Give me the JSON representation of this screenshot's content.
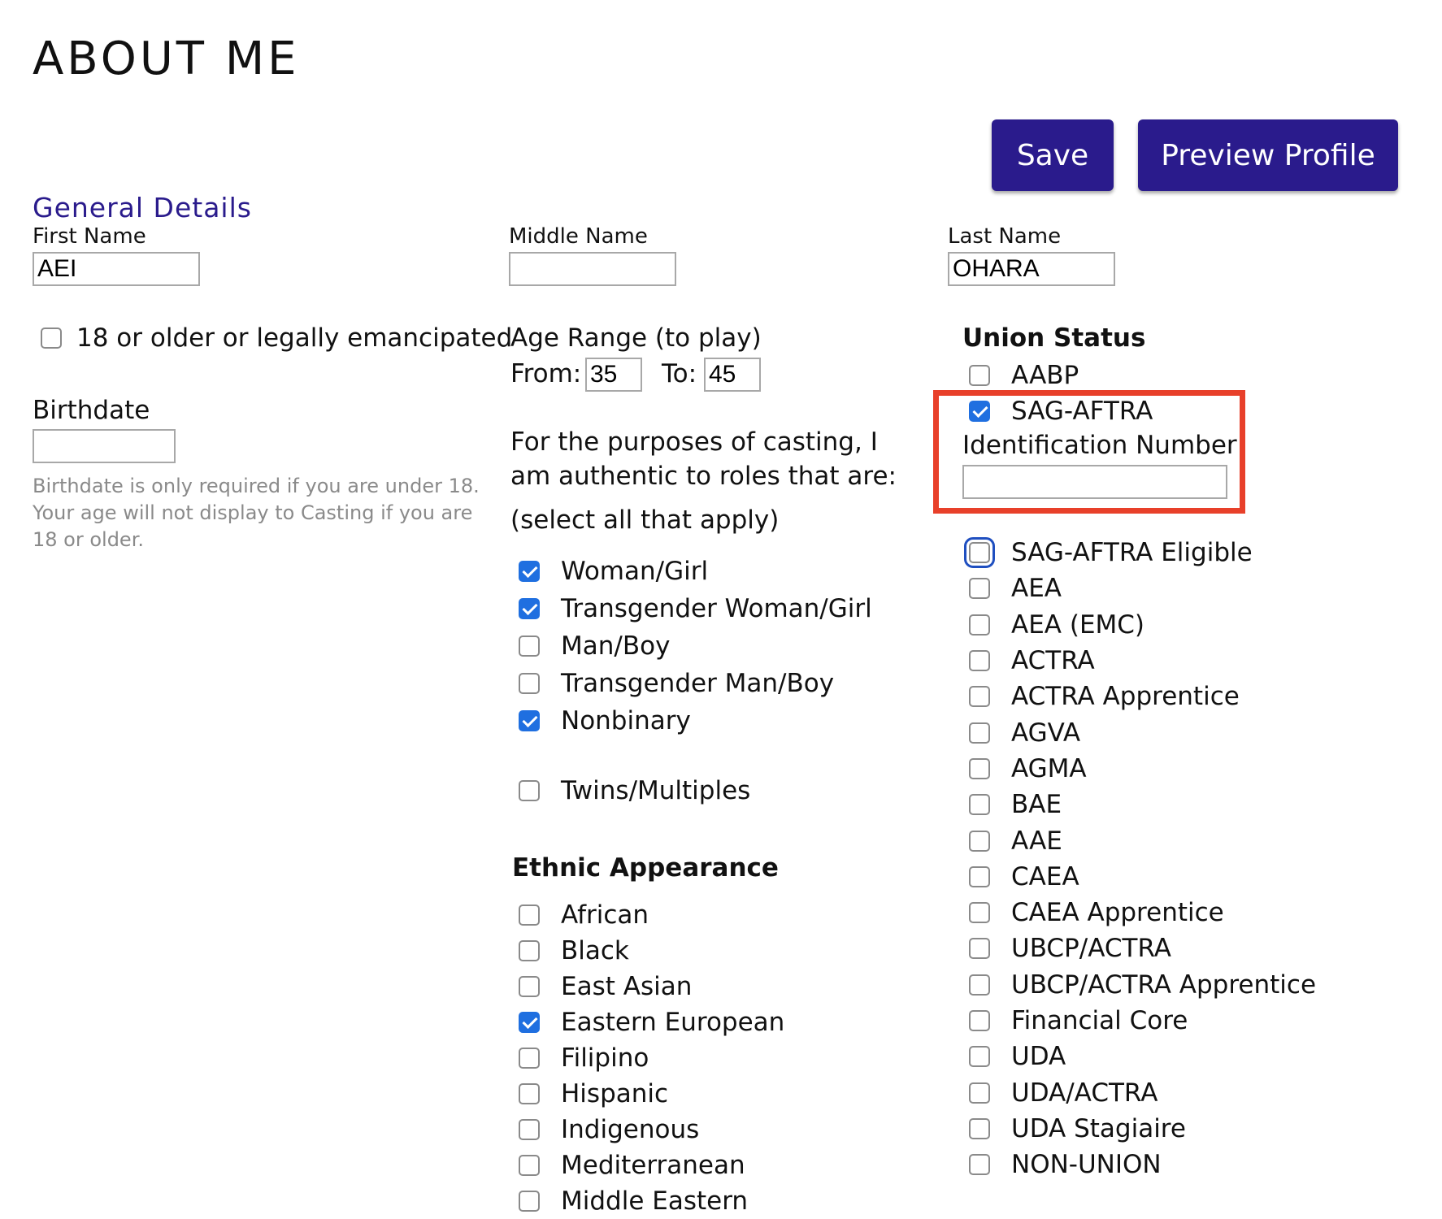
{
  "page": {
    "title": "ABOUT ME"
  },
  "toolbar": {
    "save_label": "Save",
    "preview_label": "Preview Profile",
    "accent": "#2a1b8c"
  },
  "general": {
    "title": "General Details",
    "first_name_label": "First Name",
    "first_name_value": "AEI",
    "middle_name_label": "Middle Name",
    "middle_name_value": "",
    "last_name_label": "Last Name",
    "last_name_value": "OHARA",
    "adult_label": "18 or older or legally emancipated",
    "adult_checked": false,
    "birthdate_label": "Birthdate",
    "birthdate_value": "",
    "birthdate_hint": "Birthdate is only required if you are under 18. Your age will not display to Casting if you are 18 or older."
  },
  "age_range": {
    "title": "Age Range (to play)",
    "from_label": "From:",
    "from_value": "35",
    "to_label": "To:",
    "to_value": "45"
  },
  "casting": {
    "line1": "For the purposes of casting, I",
    "line2": "am authentic to roles that are:",
    "line3": "(select all that apply)",
    "options": [
      {
        "label": "Woman/Girl",
        "checked": true
      },
      {
        "label": "Transgender Woman/Girl",
        "checked": true
      },
      {
        "label": "Man/Boy",
        "checked": false
      },
      {
        "label": "Transgender Man/Boy",
        "checked": false
      },
      {
        "label": "Nonbinary",
        "checked": true
      }
    ],
    "twins_label": "Twins/Multiples",
    "twins_checked": false
  },
  "ethnic": {
    "title": "Ethnic Appearance",
    "options": [
      {
        "label": "African",
        "checked": false
      },
      {
        "label": "Black",
        "checked": false
      },
      {
        "label": "East Asian",
        "checked": false
      },
      {
        "label": "Eastern European",
        "checked": true
      },
      {
        "label": "Filipino",
        "checked": false
      },
      {
        "label": "Hispanic",
        "checked": false
      },
      {
        "label": "Indigenous",
        "checked": false
      },
      {
        "label": "Mediterranean",
        "checked": false
      },
      {
        "label": "Middle Eastern",
        "checked": false
      }
    ]
  },
  "union": {
    "title": "Union Status",
    "aabp_label": "AABP",
    "aabp_checked": false,
    "sag_label": "SAG-AFTRA",
    "sag_checked": true,
    "id_label": "Identification Number",
    "id_value": "",
    "highlight_color": "#e8402a",
    "options": [
      {
        "label": "SAG-AFTRA Eligible",
        "checked": false,
        "focused": true
      },
      {
        "label": "AEA",
        "checked": false
      },
      {
        "label": "AEA (EMC)",
        "checked": false
      },
      {
        "label": "ACTRA",
        "checked": false
      },
      {
        "label": "ACTRA Apprentice",
        "checked": false
      },
      {
        "label": "AGVA",
        "checked": false
      },
      {
        "label": "AGMA",
        "checked": false
      },
      {
        "label": "BAE",
        "checked": false
      },
      {
        "label": "AAE",
        "checked": false
      },
      {
        "label": "CAEA",
        "checked": false
      },
      {
        "label": "CAEA Apprentice",
        "checked": false
      },
      {
        "label": "UBCP/ACTRA",
        "checked": false
      },
      {
        "label": "UBCP/ACTRA Apprentice",
        "checked": false
      },
      {
        "label": "Financial Core",
        "checked": false
      },
      {
        "label": "UDA",
        "checked": false
      },
      {
        "label": "UDA/ACTRA",
        "checked": false
      },
      {
        "label": "UDA Stagiaire",
        "checked": false
      },
      {
        "label": "NON-UNION",
        "checked": false
      }
    ]
  }
}
